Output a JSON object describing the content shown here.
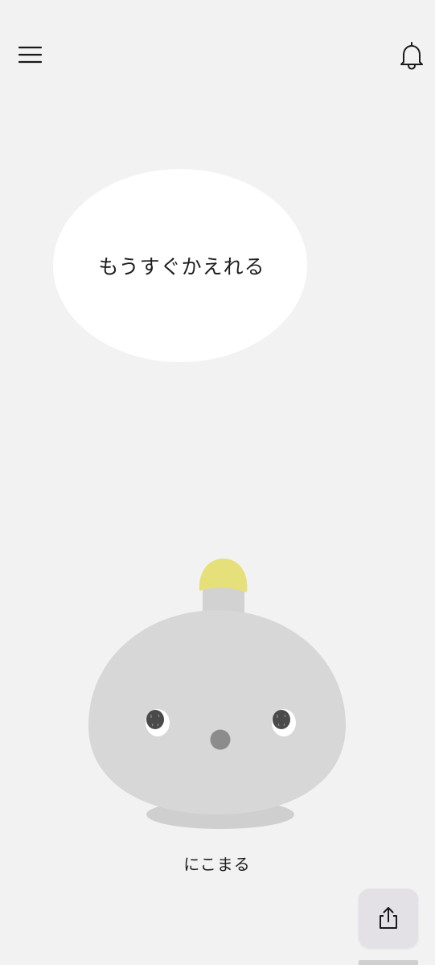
{
  "header": {
    "menu_icon": "hamburger-menu-icon",
    "notification_icon": "bell-icon"
  },
  "speech_bubble": {
    "text": "もうすぐかえれる"
  },
  "character": {
    "name": "にこまる",
    "colors": {
      "body": "#d7d7d7",
      "antenna_tip": "#e6e07a",
      "nose": "#8c8c8c",
      "eyes": "#4a4a4a"
    }
  },
  "share": {
    "icon": "share-icon"
  }
}
